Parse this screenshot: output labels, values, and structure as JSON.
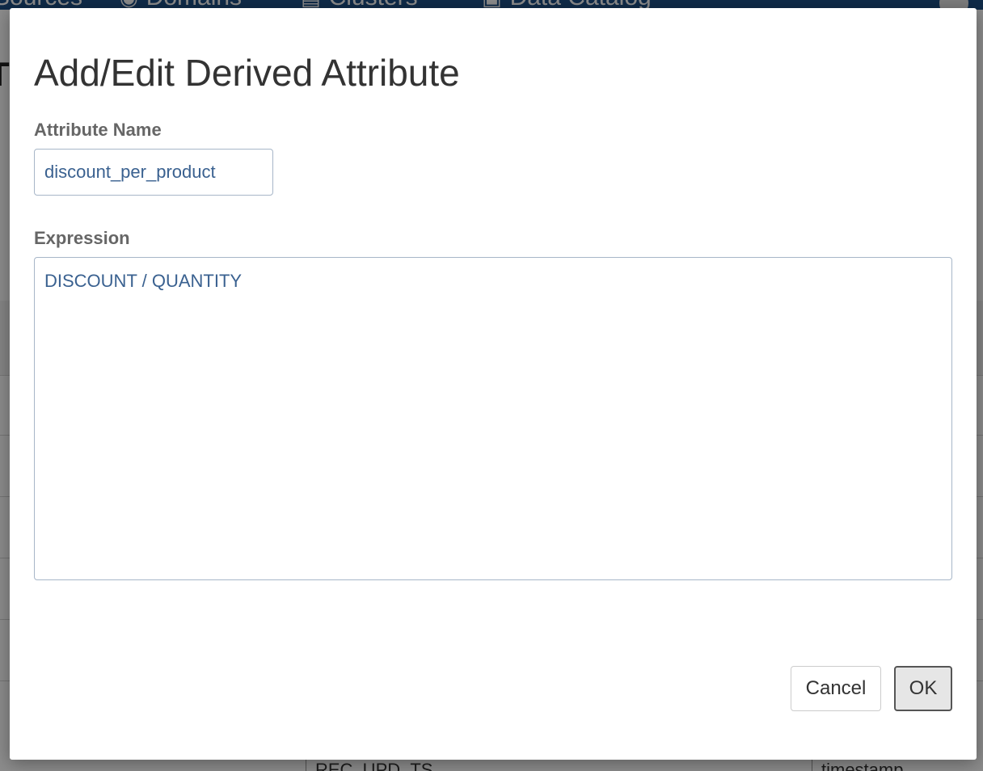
{
  "background": {
    "nav_items": [
      {
        "label": "Sources",
        "icon": "database-icon"
      },
      {
        "label": "Domains",
        "icon": "globe-icon"
      },
      {
        "label": "Clusters",
        "icon": "server-icon"
      },
      {
        "label": "Data Catalog",
        "icon": "book-icon"
      }
    ],
    "heading_stub": "T",
    "table_cells": [
      "REC_UPD_TS",
      "timestamp"
    ]
  },
  "dialog": {
    "title": "Add/Edit Derived Attribute",
    "attribute_name_label": "Attribute Name",
    "attribute_name_value": "discount_per_product",
    "expression_label": "Expression",
    "expression_value": "DISCOUNT / QUANTITY",
    "cancel_label": "Cancel",
    "ok_label": "OK"
  },
  "colors": {
    "navbar": "#1d4f86",
    "input_text": "#3a6190",
    "input_border": "#a7b6c8",
    "title_text": "#333333",
    "label_text": "#666666"
  }
}
